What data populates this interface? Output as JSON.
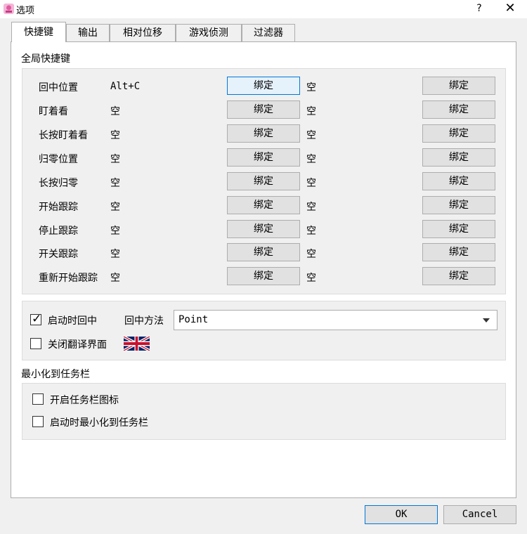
{
  "window": {
    "title": "选项",
    "help_glyph": "?",
    "close_glyph": "✕"
  },
  "tabs": [
    {
      "label": "快捷键",
      "active": true
    },
    {
      "label": "输出"
    },
    {
      "label": "相对位移"
    },
    {
      "label": "游戏侦测"
    },
    {
      "label": "过滤器"
    }
  ],
  "global_hotkeys": {
    "title": "全局快捷键",
    "bind_label": "绑定",
    "rows": [
      {
        "label": "回中位置",
        "value1": "Alt+C",
        "value2": "空"
      },
      {
        "label": "盯着看",
        "value1": "空",
        "value2": "空"
      },
      {
        "label": "长按盯着看",
        "value1": "空",
        "value2": "空"
      },
      {
        "label": "归零位置",
        "value1": "空",
        "value2": "空"
      },
      {
        "label": "长按归零",
        "value1": "空",
        "value2": "空"
      },
      {
        "label": "开始跟踪",
        "value1": "空",
        "value2": "空"
      },
      {
        "label": "停止跟踪",
        "value1": "空",
        "value2": "空"
      },
      {
        "label": "开关跟踪",
        "value1": "空",
        "value2": "空"
      },
      {
        "label": "重新开始跟踪",
        "value1": "空",
        "value2": "空"
      }
    ]
  },
  "options": {
    "center_on_start": {
      "label": "启动时回中",
      "checked": true
    },
    "center_method": {
      "label": "回中方法",
      "value": "Point"
    },
    "close_translation": {
      "label": "关闭翻译界面",
      "checked": false
    }
  },
  "tray": {
    "title": "最小化到任务栏",
    "enable_tray_icon": {
      "label": "开启任务栏图标",
      "checked": false
    },
    "start_minimized": {
      "label": "启动时最小化到任务栏",
      "checked": false
    }
  },
  "footer": {
    "ok_label": "OK",
    "cancel_label": "Cancel"
  },
  "colors": {
    "accent": "#0078d7",
    "face": "#f0f0f0"
  },
  "icons": {
    "app": "app-icon",
    "flag": "uk-flag-icon"
  }
}
